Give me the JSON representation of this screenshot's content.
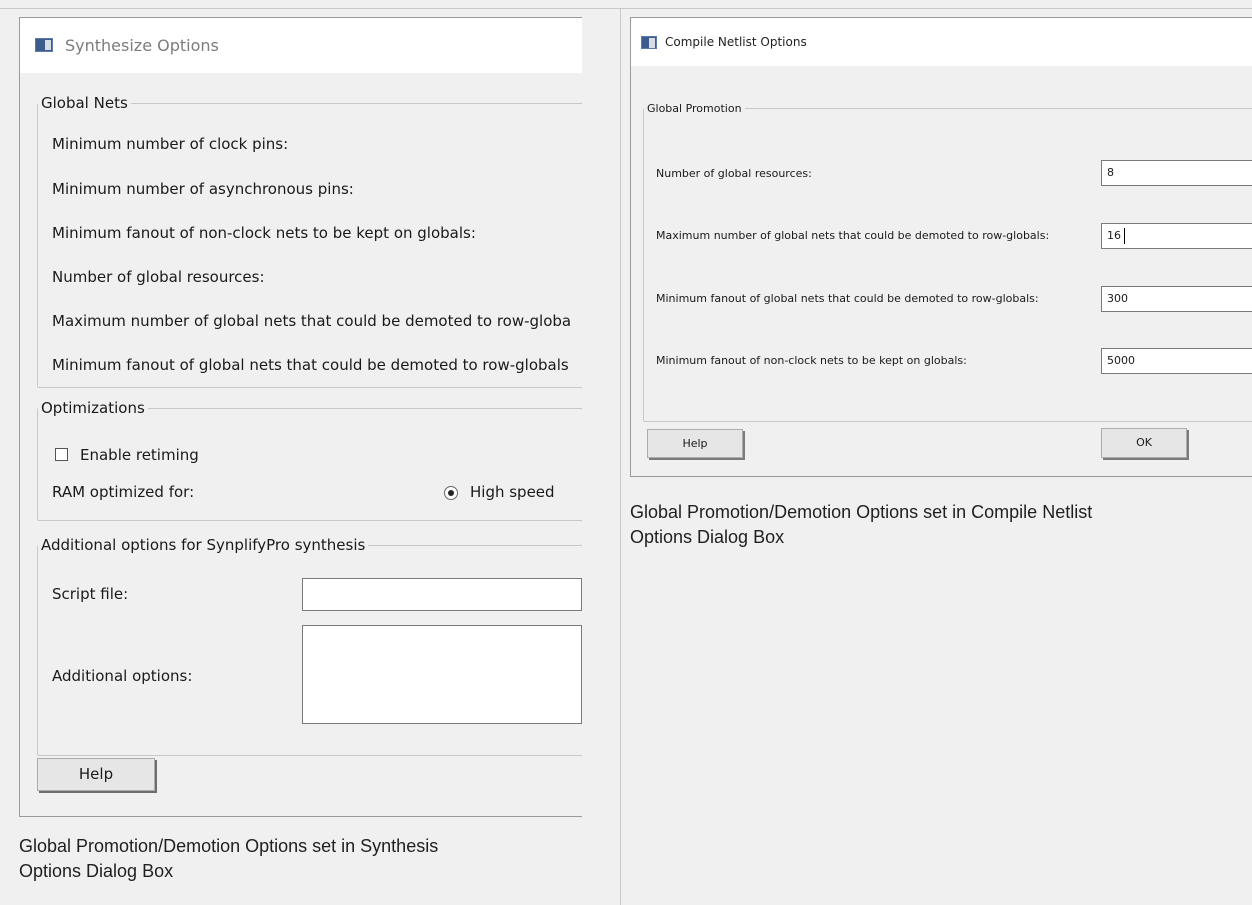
{
  "synthesize": {
    "title": "Synthesize Options",
    "global_nets": {
      "legend": "Global Nets",
      "rows": [
        "Minimum number of clock pins:",
        "Minimum number of asynchronous pins:",
        "Minimum fanout of non-clock nets to be kept on globals:",
        "Number of global resources:",
        "Maximum number of global nets that could be demoted to row-globa",
        "Minimum fanout of global nets that could be demoted to row-globals"
      ]
    },
    "optimizations": {
      "legend": "Optimizations",
      "enable_retiming_label": "Enable retiming",
      "ram_label": "RAM optimized for:",
      "ram_option": "High speed"
    },
    "additional": {
      "legend": "Additional options for SynplifyPro synthesis",
      "script_file_label": "Script file:",
      "script_file_value": "",
      "additional_options_label": "Additional options:",
      "additional_options_value": ""
    },
    "help_label": "Help",
    "caption_line1": "Global Promotion/Demotion Options set in Synthesis",
    "caption_line2": "Options Dialog Box"
  },
  "compile": {
    "title": "Compile Netlist Options",
    "group_legend": "Global Promotion",
    "rows": [
      {
        "label": "Number of global resources:",
        "value": "8"
      },
      {
        "label": "Maximum number of global nets that could be demoted to row-globals:",
        "value": "16"
      },
      {
        "label": "Minimum fanout of global nets that could be demoted to row-globals:",
        "value": "300"
      },
      {
        "label": "Minimum fanout of non-clock nets to be kept on globals:",
        "value": "5000"
      }
    ],
    "help_label": "Help",
    "ok_label": "OK",
    "caption_line1": "Global Promotion/Demotion Options set in Compile Netlist",
    "caption_line2": "Options Dialog Box"
  }
}
